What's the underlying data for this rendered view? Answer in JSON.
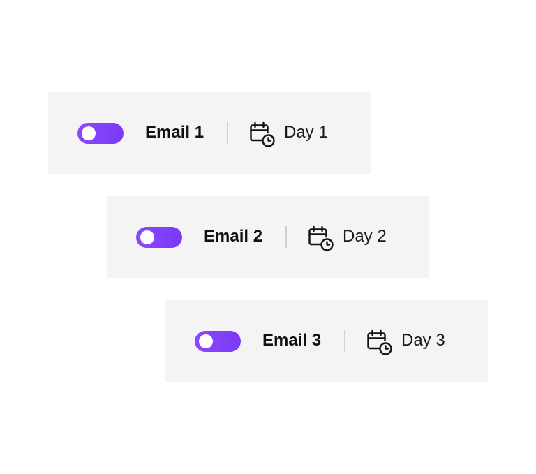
{
  "accent_color": "#7a3af5",
  "emails": [
    {
      "label": "Email 1",
      "day": "Day 1",
      "enabled": true,
      "icon": "calendar-clock-icon"
    },
    {
      "label": "Email 2",
      "day": "Day 2",
      "enabled": true,
      "icon": "calendar-clock-icon"
    },
    {
      "label": "Email 3",
      "day": "Day 3",
      "enabled": true,
      "icon": "calendar-clock-icon"
    }
  ]
}
